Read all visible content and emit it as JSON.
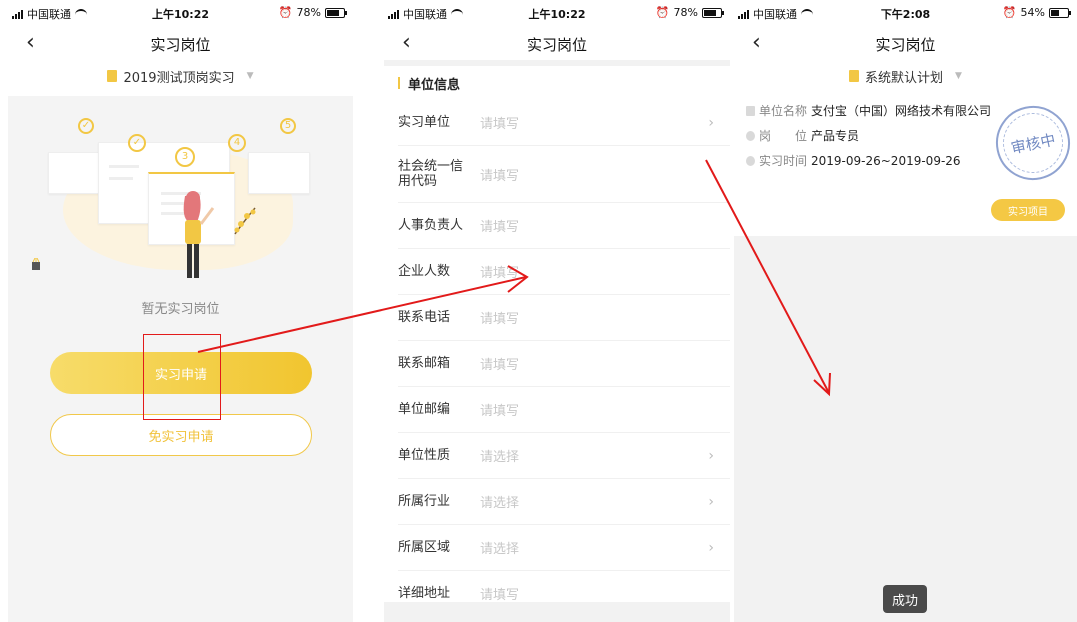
{
  "screen1": {
    "status": {
      "carrier": "中国联通",
      "time": "上午10:22",
      "battery": "78%"
    },
    "nav_title": "实习岗位",
    "plan_label": "2019测试顶岗实习",
    "empty_text": "暂无实习岗位",
    "apply_button": "实习申请",
    "exempt_button": "免实习申请"
  },
  "screen2": {
    "status": {
      "carrier": "中国联通",
      "time": "上午10:22",
      "battery": "78%"
    },
    "nav_title": "实习岗位",
    "section_title": "单位信息",
    "fields": [
      {
        "label": "实习单位",
        "placeholder": "请填写",
        "arrow": true
      },
      {
        "label": "社会统一信用代码",
        "placeholder": "请填写",
        "arrow": false
      },
      {
        "label": "人事负责人",
        "placeholder": "请填写",
        "arrow": false
      },
      {
        "label": "企业人数",
        "placeholder": "请填写",
        "arrow": false
      },
      {
        "label": "联系电话",
        "placeholder": "请填写",
        "arrow": false
      },
      {
        "label": "联系邮箱",
        "placeholder": "请填写",
        "arrow": false
      },
      {
        "label": "单位邮编",
        "placeholder": "请填写",
        "arrow": false
      },
      {
        "label": "单位性质",
        "placeholder": "请选择",
        "arrow": true
      },
      {
        "label": "所属行业",
        "placeholder": "请选择",
        "arrow": true
      },
      {
        "label": "所属区域",
        "placeholder": "请选择",
        "arrow": true
      },
      {
        "label": "详细地址",
        "placeholder": "请填写",
        "arrow": false
      }
    ],
    "chevron": "›"
  },
  "screen3": {
    "status": {
      "carrier": "中国联通",
      "time": "下午2:08",
      "battery": "54%"
    },
    "nav_title": "实习岗位",
    "plan_label": "系统默认计划",
    "company_label": "单位名称",
    "company_value": "支付宝（中国）网络技术有限公司",
    "position_label": "岗　　位",
    "position_value": "产品专员",
    "time_label": "实习时间",
    "time_value": "2019-09-26~2019-09-26",
    "stamp_text": "审核中",
    "project_button": "实习项目",
    "toast": "成功"
  },
  "icons": {
    "back": "‹",
    "caret": "▼"
  },
  "colors": {
    "accent": "#f2c744",
    "annotation": "#e21a1a",
    "stamp": "#5a76b8"
  }
}
